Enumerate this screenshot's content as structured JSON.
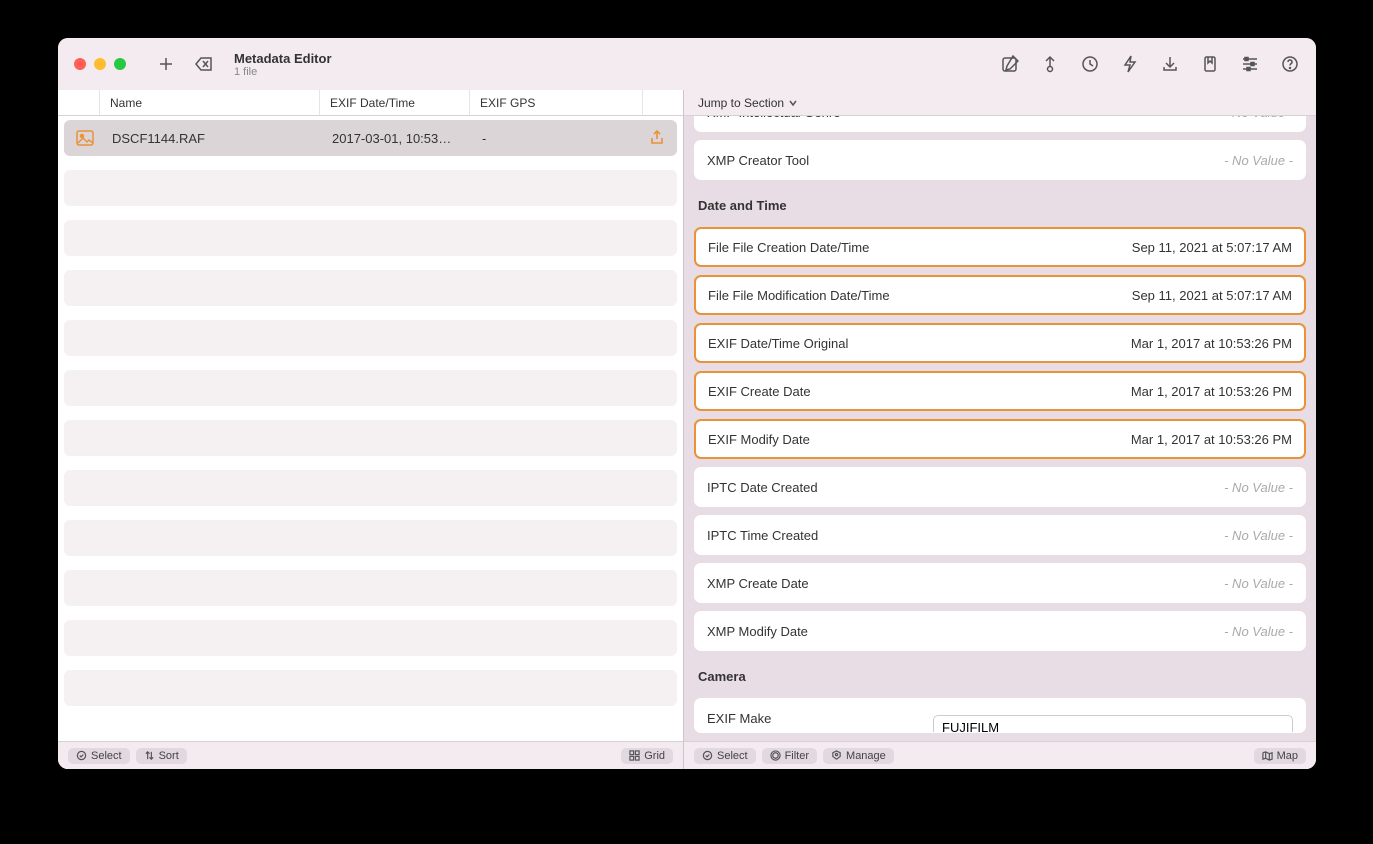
{
  "window": {
    "title": "Metadata Editor",
    "subtitle": "1 file"
  },
  "columns": {
    "name": "Name",
    "date": "EXIF Date/Time",
    "gps": "EXIF GPS"
  },
  "file_row": {
    "name": "DSCF1144.RAF",
    "date": "2017-03-01, 10:53…",
    "gps": "-"
  },
  "jump": {
    "label": "Jump to Section"
  },
  "novalue": "- No Value -",
  "metadata": {
    "pre_rows": [
      {
        "label": "XMP Intellectual Genre",
        "value": null
      },
      {
        "label": "XMP Creator Tool",
        "value": null
      }
    ],
    "date_section": "Date and Time",
    "date_rows": [
      {
        "label": "File File Creation Date/Time",
        "value": "Sep 11, 2021 at 5:07:17 AM",
        "hl": true
      },
      {
        "label": "File File Modification Date/Time",
        "value": "Sep 11, 2021 at 5:07:17 AM",
        "hl": true
      },
      {
        "label": "EXIF Date/Time Original",
        "value": "Mar 1, 2017 at 10:53:26 PM",
        "hl": true
      },
      {
        "label": "EXIF Create Date",
        "value": "Mar 1, 2017 at 10:53:26 PM",
        "hl": true
      },
      {
        "label": "EXIF Modify Date",
        "value": "Mar 1, 2017 at 10:53:26 PM",
        "hl": true
      },
      {
        "label": "IPTC Date Created",
        "value": null,
        "hl": false
      },
      {
        "label": "IPTC Time Created",
        "value": null,
        "hl": false
      },
      {
        "label": "XMP Create Date",
        "value": null,
        "hl": false
      },
      {
        "label": "XMP Modify Date",
        "value": null,
        "hl": false
      }
    ],
    "camera_section": "Camera",
    "camera": {
      "make_label": "EXIF Make",
      "make_value": "FUJIFILM"
    }
  },
  "footer_left": {
    "select": "Select",
    "sort": "Sort",
    "grid": "Grid"
  },
  "footer_right": {
    "select": "Select",
    "filter": "Filter",
    "manage": "Manage",
    "map": "Map"
  }
}
